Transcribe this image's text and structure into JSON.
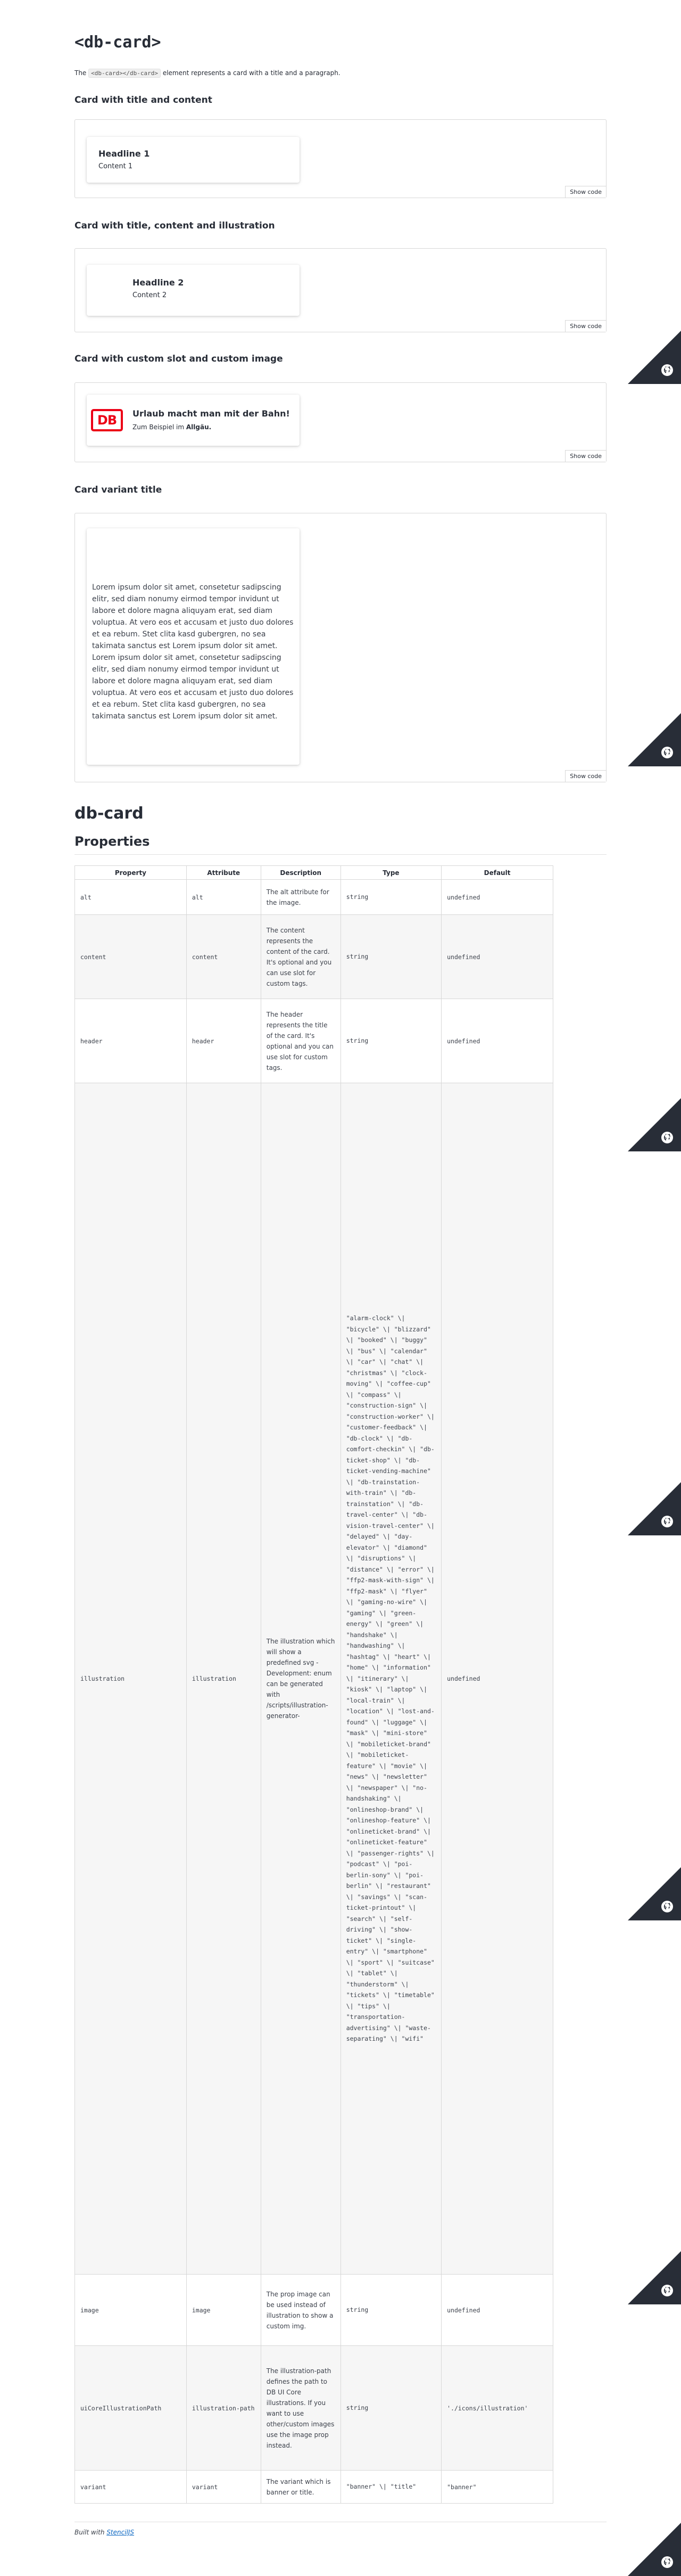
{
  "page": {
    "title": "<db-card>",
    "intro_prefix": "The",
    "intro_code": "<db-card></db-card>",
    "intro_suffix": "element represents a card with a title and a paragraph."
  },
  "examples": [
    {
      "title": "Card with title and content",
      "headline": "Headline 1",
      "content": "Content 1",
      "show_code": "Show code"
    },
    {
      "title": "Card with title, content and illustration",
      "headline": "Headline 2",
      "content": "Content 2",
      "show_code": "Show code"
    },
    {
      "title": "Card with custom slot and custom image",
      "logo_text": "DB",
      "headline": "Urlaub macht man mit der Bahn!",
      "content_prefix": "Zum Beispiel im",
      "content_bold": "Allgäu.",
      "show_code": "Show code"
    },
    {
      "title": "Card variant title",
      "text": "Lorem ipsum dolor sit amet, consetetur sadipscing elitr, sed diam nonumy eirmod tempor invidunt ut labore et dolore magna aliquyam erat, sed diam voluptua. At vero eos et accusam et justo duo dolores et ea rebum. Stet clita kasd gubergren, no sea takimata sanctus est Lorem ipsum dolor sit amet. Lorem ipsum dolor sit amet, consetetur sadipscing elitr, sed diam nonumy eirmod tempor invidunt ut labore et dolore magna aliquyam erat, sed diam voluptua. At vero eos et accusam et justo duo dolores et ea rebum. Stet clita kasd gubergren, no sea takimata sanctus est Lorem ipsum dolor sit amet.",
      "show_code": "Show code"
    }
  ],
  "component_title": "db-card",
  "properties_title": "Properties",
  "table": {
    "headers": [
      "Property",
      "Attribute",
      "Description",
      "Type",
      "Default"
    ],
    "rows": [
      {
        "property": "alt",
        "attribute": "alt",
        "description": "The alt attribute for the image.",
        "type": "string",
        "default": "undefined"
      },
      {
        "property": "content",
        "attribute": "content",
        "description": "The content represents the content of the card. It's optional and you can use slot for custom tags.",
        "type": "string",
        "default": "undefined"
      },
      {
        "property": "header",
        "attribute": "header",
        "description": "The header represents the title of the card. It's optional and you can use slot for custom tags.",
        "type": "string",
        "default": "undefined"
      },
      {
        "property": "illustration",
        "attribute": "illustration",
        "description": "The illustration which will show a predefined svg - Development: enum can be generated with /scripts/illustration-generator-",
        "type": "\"alarm-clock\" \\| \"bicycle\" \\| \"blizzard\" \\| \"booked\" \\| \"buggy\" \\| \"bus\" \\| \"calendar\" \\| \"car\" \\| \"chat\" \\| \"christmas\" \\| \"clock-moving\" \\| \"coffee-cup\" \\| \"compass\" \\| \"construction-sign\" \\| \"construction-worker\" \\| \"customer-feedback\" \\| \"db-clock\" \\| \"db-comfort-checkin\" \\| \"db-ticket-shop\" \\| \"db-ticket-vending-machine\" \\| \"db-trainstation-with-train\" \\| \"db-trainstation\" \\| \"db-travel-center\" \\| \"db-vision-travel-center\" \\| \"delayed\" \\| \"day-elevator\" \\| \"diamond\" \\| \"disruptions\" \\| \"distance\" \\| \"error\" \\| \"ffp2-mask-with-sign\" \\| \"ffp2-mask\" \\| \"flyer\" \\| \"gaming-no-wire\" \\| \"gaming\" \\| \"green-energy\" \\| \"green\" \\| \"handshake\" \\| \"handwashing\" \\| \"hashtag\" \\| \"heart\" \\| \"home\" \\| \"information\" \\| \"itinerary\" \\| \"kiosk\" \\| \"laptop\" \\| \"local-train\" \\| \"location\" \\| \"lost-and-found\" \\| \"luggage\" \\| \"mask\" \\| \"mini-store\" \\| \"mobileticket-brand\" \\| \"mobileticket-feature\" \\| \"movie\" \\| \"news\" \\| \"newsletter\" \\| \"newspaper\" \\| \"no-handshaking\" \\| \"onlineshop-brand\" \\| \"onlineshop-feature\" \\| \"onlineticket-brand\" \\| \"onlineticket-feature\" \\| \"passenger-rights\" \\| \"podcast\" \\| \"poi-berlin-sony\" \\| \"poi-berlin\" \\| \"restaurant\" \\| \"savings\" \\| \"scan-ticket-printout\" \\| \"search\" \\| \"self-driving\" \\| \"show-ticket\" \\| \"single-entry\" \\| \"smartphone\" \\| \"sport\" \\| \"suitcase\" \\| \"tablet\" \\| \"thunderstorm\" \\| \"tickets\" \\| \"timetable\" \\| \"tips\" \\| \"transportation-advertising\" \\| \"waste-separating\" \\| \"wifi\"",
        "default": "undefined"
      },
      {
        "property": "image",
        "attribute": "image",
        "description": "The prop image can be used instead of illustration to show a custom img.",
        "type": "string",
        "default": "undefined"
      },
      {
        "property": "uiCoreIllustrationPath",
        "attribute": "illustration-path",
        "description": "The illustration-path defines the path to DB UI Core illustrations. If you want to use other/custom images use the image prop instead.",
        "type": "string",
        "default": "'./icons/illustration'"
      },
      {
        "property": "variant",
        "attribute": "variant",
        "description": "The variant which is banner or title.",
        "type": "\"banner\" \\| \"title\"",
        "default": "\"banner\""
      }
    ]
  },
  "footer": {
    "prefix": "Built with",
    "link": "StencilJS"
  },
  "colors": {
    "db_red": "#ec0016",
    "text": "#282d37",
    "github_corner": "#282d37"
  }
}
